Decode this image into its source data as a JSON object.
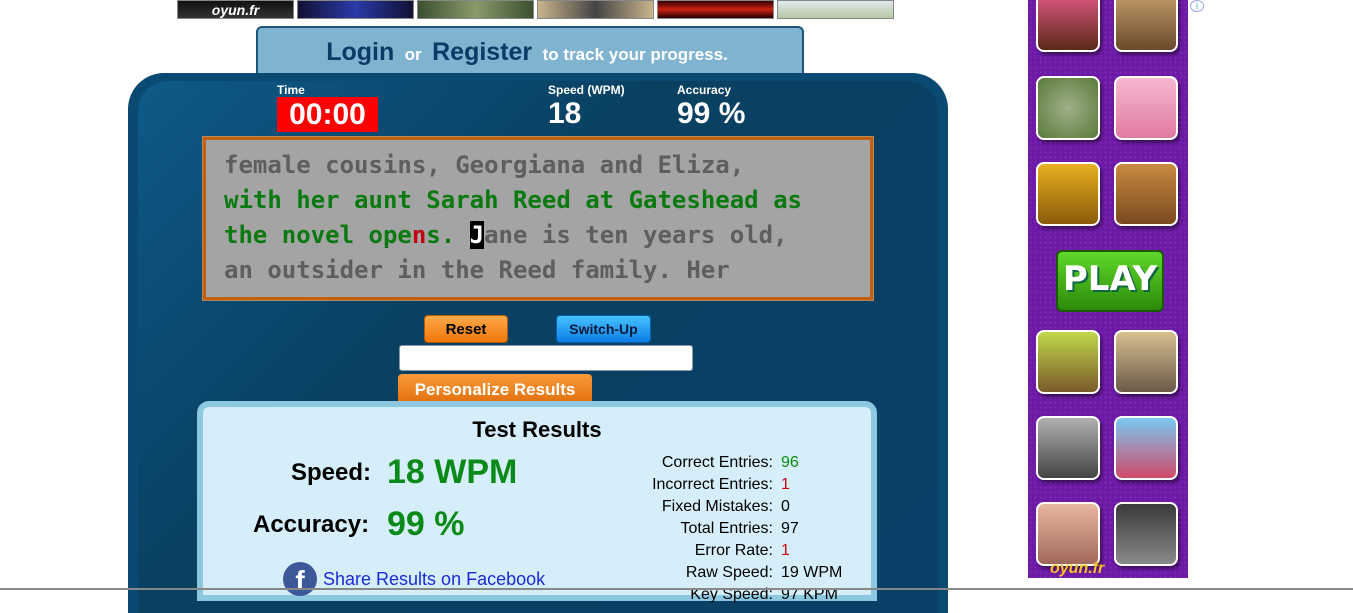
{
  "top_strip": {
    "brand": "oyun.fr"
  },
  "login_banner": {
    "login": "Login",
    "or": "or",
    "register": "Register",
    "suffix": "to track your progress."
  },
  "stats": {
    "time_label": "Time",
    "time_value": "00:00",
    "speed_label": "Speed (WPM)",
    "speed_value": "18",
    "accuracy_label": "Accuracy",
    "accuracy_value": "99 %"
  },
  "typing": {
    "line1": "female cousins, Georgiana and Eliza,",
    "line2": "with her aunt Sarah Reed at Gateshead as",
    "line3_typed": "the novel ope",
    "line3_error": "n",
    "line3_typed2": "s. ",
    "line3_cursor": "J",
    "line3_rest": "ane is ten years old,",
    "line4": "an outsider in the Reed family. Her"
  },
  "buttons": {
    "reset": "Reset",
    "switch_up": "Switch-Up",
    "personalize": "Personalize Results"
  },
  "results": {
    "title": "Test Results",
    "speed_label": "Speed:",
    "speed_value": "18 WPM",
    "accuracy_label": "Accuracy:",
    "accuracy_value": "99 %",
    "share_text": "Share Results on Facebook",
    "rows": [
      {
        "k": "Correct Entries:",
        "v": "96"
      },
      {
        "k": "Incorrect Entries:",
        "v": "1"
      },
      {
        "k": "Fixed Mistakes:",
        "v": "0"
      },
      {
        "k": "Total Entries:",
        "v": "97"
      },
      {
        "k": "Error Rate:",
        "v": "1"
      },
      {
        "k": "Raw Speed:",
        "v": "19 WPM"
      },
      {
        "k": "Key Speed:",
        "v": "97 KPM"
      }
    ]
  },
  "ad": {
    "play": "PLAY",
    "brand": "oyun.fr",
    "info": "i"
  },
  "colors": {
    "panel": "#0a4a72",
    "timer": "#ff0000",
    "correct": "#0a7a10",
    "error": "#c00010",
    "ad_bg": "#6d1aa6"
  }
}
